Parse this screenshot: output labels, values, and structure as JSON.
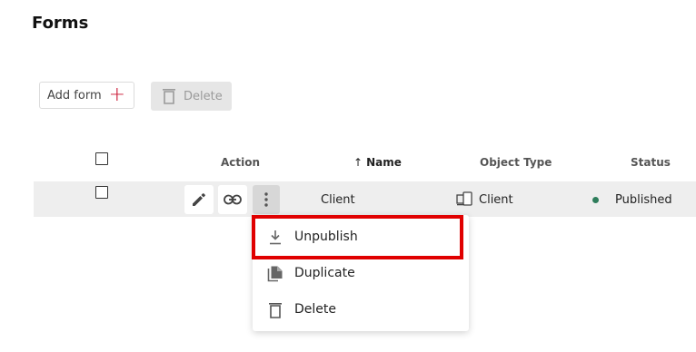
{
  "page": {
    "title": "Forms"
  },
  "toolbar": {
    "add_label": "Add form",
    "add_icon": "plus-icon",
    "delete_label": "Delete",
    "delete_icon": "trash-icon"
  },
  "table": {
    "headers": {
      "action": "Action",
      "name": "Name",
      "object_type": "Object Type",
      "status": "Status"
    },
    "sort": {
      "column": "name",
      "direction": "ascending"
    },
    "rows": [
      {
        "name": "Client",
        "object_type": "Client",
        "status": "Published",
        "status_color": "#2e7d5b"
      }
    ]
  },
  "row_actions": {
    "edit_icon": "pencil-icon",
    "link_icon": "link-icon",
    "more_icon": "more-vertical-icon"
  },
  "context_menu": {
    "items": [
      {
        "label": "Unpublish",
        "icon": "unpublish-icon"
      },
      {
        "label": "Duplicate",
        "icon": "duplicate-icon"
      },
      {
        "label": "Delete",
        "icon": "trash-icon"
      }
    ],
    "highlighted_item": "Unpublish",
    "highlight_color": "#e00000"
  }
}
